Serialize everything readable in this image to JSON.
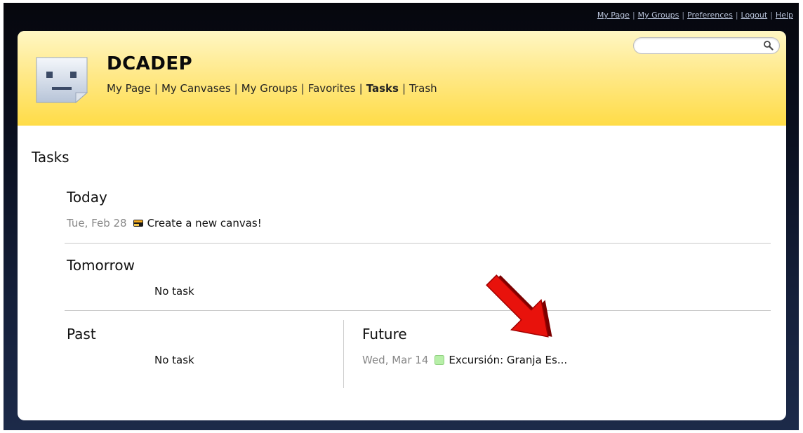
{
  "top_links": [
    "My Page",
    "My Groups",
    "Preferences",
    "Logout",
    "Help"
  ],
  "header": {
    "title": "DCADEP",
    "nav": [
      {
        "label": "My Page",
        "active": false
      },
      {
        "label": "My Canvases",
        "active": false
      },
      {
        "label": "My Groups",
        "active": false
      },
      {
        "label": "Favorites",
        "active": false
      },
      {
        "label": "Tasks",
        "active": true
      },
      {
        "label": "Trash",
        "active": false
      }
    ],
    "search": {
      "value": "",
      "placeholder": ""
    }
  },
  "page_title": "Tasks",
  "sections": {
    "today": {
      "title": "Today",
      "tasks": [
        {
          "date": "Tue, Feb 28",
          "label": "Create a new canvas!",
          "icon": "canvas-task-icon"
        }
      ]
    },
    "tomorrow": {
      "title": "Tomorrow",
      "empty_text": "No task"
    },
    "past": {
      "title": "Past",
      "empty_text": "No task"
    },
    "future": {
      "title": "Future",
      "tasks": [
        {
          "date": "Wed, Mar 14",
          "label": "Excursión: Granja Es...",
          "icon": "green-square-icon"
        }
      ]
    }
  },
  "colors": {
    "header_yellow": "#ffdc47",
    "annotation_arrow": "#e8120c"
  }
}
